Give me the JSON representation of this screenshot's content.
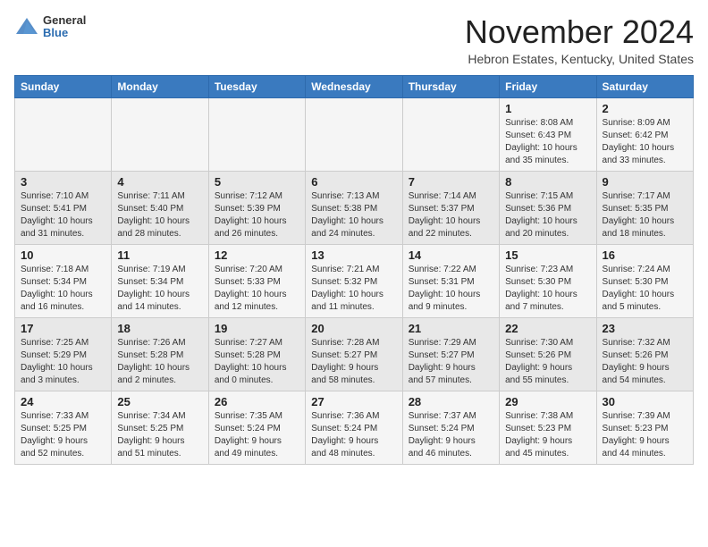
{
  "header": {
    "logo_general": "General",
    "logo_blue": "Blue",
    "month_title": "November 2024",
    "location": "Hebron Estates, Kentucky, United States"
  },
  "days_of_week": [
    "Sunday",
    "Monday",
    "Tuesday",
    "Wednesday",
    "Thursday",
    "Friday",
    "Saturday"
  ],
  "weeks": [
    [
      {
        "day": "",
        "info": ""
      },
      {
        "day": "",
        "info": ""
      },
      {
        "day": "",
        "info": ""
      },
      {
        "day": "",
        "info": ""
      },
      {
        "day": "",
        "info": ""
      },
      {
        "day": "1",
        "info": "Sunrise: 8:08 AM\nSunset: 6:43 PM\nDaylight: 10 hours\nand 35 minutes."
      },
      {
        "day": "2",
        "info": "Sunrise: 8:09 AM\nSunset: 6:42 PM\nDaylight: 10 hours\nand 33 minutes."
      }
    ],
    [
      {
        "day": "3",
        "info": "Sunrise: 7:10 AM\nSunset: 5:41 PM\nDaylight: 10 hours\nand 31 minutes."
      },
      {
        "day": "4",
        "info": "Sunrise: 7:11 AM\nSunset: 5:40 PM\nDaylight: 10 hours\nand 28 minutes."
      },
      {
        "day": "5",
        "info": "Sunrise: 7:12 AM\nSunset: 5:39 PM\nDaylight: 10 hours\nand 26 minutes."
      },
      {
        "day": "6",
        "info": "Sunrise: 7:13 AM\nSunset: 5:38 PM\nDaylight: 10 hours\nand 24 minutes."
      },
      {
        "day": "7",
        "info": "Sunrise: 7:14 AM\nSunset: 5:37 PM\nDaylight: 10 hours\nand 22 minutes."
      },
      {
        "day": "8",
        "info": "Sunrise: 7:15 AM\nSunset: 5:36 PM\nDaylight: 10 hours\nand 20 minutes."
      },
      {
        "day": "9",
        "info": "Sunrise: 7:17 AM\nSunset: 5:35 PM\nDaylight: 10 hours\nand 18 minutes."
      }
    ],
    [
      {
        "day": "10",
        "info": "Sunrise: 7:18 AM\nSunset: 5:34 PM\nDaylight: 10 hours\nand 16 minutes."
      },
      {
        "day": "11",
        "info": "Sunrise: 7:19 AM\nSunset: 5:34 PM\nDaylight: 10 hours\nand 14 minutes."
      },
      {
        "day": "12",
        "info": "Sunrise: 7:20 AM\nSunset: 5:33 PM\nDaylight: 10 hours\nand 12 minutes."
      },
      {
        "day": "13",
        "info": "Sunrise: 7:21 AM\nSunset: 5:32 PM\nDaylight: 10 hours\nand 11 minutes."
      },
      {
        "day": "14",
        "info": "Sunrise: 7:22 AM\nSunset: 5:31 PM\nDaylight: 10 hours\nand 9 minutes."
      },
      {
        "day": "15",
        "info": "Sunrise: 7:23 AM\nSunset: 5:30 PM\nDaylight: 10 hours\nand 7 minutes."
      },
      {
        "day": "16",
        "info": "Sunrise: 7:24 AM\nSunset: 5:30 PM\nDaylight: 10 hours\nand 5 minutes."
      }
    ],
    [
      {
        "day": "17",
        "info": "Sunrise: 7:25 AM\nSunset: 5:29 PM\nDaylight: 10 hours\nand 3 minutes."
      },
      {
        "day": "18",
        "info": "Sunrise: 7:26 AM\nSunset: 5:28 PM\nDaylight: 10 hours\nand 2 minutes."
      },
      {
        "day": "19",
        "info": "Sunrise: 7:27 AM\nSunset: 5:28 PM\nDaylight: 10 hours\nand 0 minutes."
      },
      {
        "day": "20",
        "info": "Sunrise: 7:28 AM\nSunset: 5:27 PM\nDaylight: 9 hours\nand 58 minutes."
      },
      {
        "day": "21",
        "info": "Sunrise: 7:29 AM\nSunset: 5:27 PM\nDaylight: 9 hours\nand 57 minutes."
      },
      {
        "day": "22",
        "info": "Sunrise: 7:30 AM\nSunset: 5:26 PM\nDaylight: 9 hours\nand 55 minutes."
      },
      {
        "day": "23",
        "info": "Sunrise: 7:32 AM\nSunset: 5:26 PM\nDaylight: 9 hours\nand 54 minutes."
      }
    ],
    [
      {
        "day": "24",
        "info": "Sunrise: 7:33 AM\nSunset: 5:25 PM\nDaylight: 9 hours\nand 52 minutes."
      },
      {
        "day": "25",
        "info": "Sunrise: 7:34 AM\nSunset: 5:25 PM\nDaylight: 9 hours\nand 51 minutes."
      },
      {
        "day": "26",
        "info": "Sunrise: 7:35 AM\nSunset: 5:24 PM\nDaylight: 9 hours\nand 49 minutes."
      },
      {
        "day": "27",
        "info": "Sunrise: 7:36 AM\nSunset: 5:24 PM\nDaylight: 9 hours\nand 48 minutes."
      },
      {
        "day": "28",
        "info": "Sunrise: 7:37 AM\nSunset: 5:24 PM\nDaylight: 9 hours\nand 46 minutes."
      },
      {
        "day": "29",
        "info": "Sunrise: 7:38 AM\nSunset: 5:23 PM\nDaylight: 9 hours\nand 45 minutes."
      },
      {
        "day": "30",
        "info": "Sunrise: 7:39 AM\nSunset: 5:23 PM\nDaylight: 9 hours\nand 44 minutes."
      }
    ]
  ]
}
